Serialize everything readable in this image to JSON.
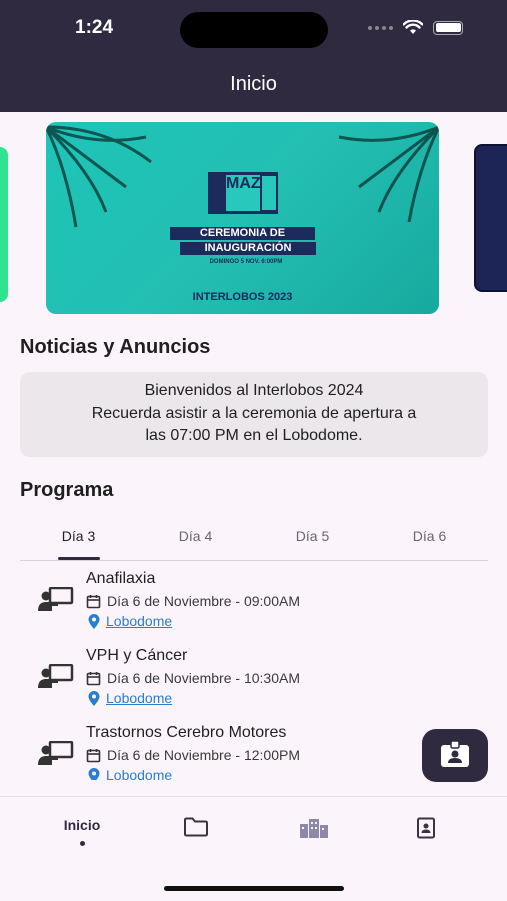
{
  "status_bar": {
    "time": "1:24"
  },
  "header": {
    "title": "Inicio"
  },
  "banner": {
    "logo_text": "MAZA",
    "line1": "CEREMONIA DE",
    "line2": "INAUGURACIÓN",
    "date": "DOMINGO 5 NOV. 6:00PM",
    "brand": "INTERLOBOS 2023"
  },
  "news": {
    "title": "Noticias y Anuncios",
    "lines": [
      "Bienvenidos al Interlobos 2024",
      "Recuerda asistir a la ceremonia de apertura a",
      "las 07:00 PM en el Lobodome."
    ]
  },
  "program": {
    "title": "Programa",
    "tabs": [
      "Día 3",
      "Día 4",
      "Día 5",
      "Día 6"
    ],
    "items": [
      {
        "title": "Anafilaxia",
        "date": "Día 6 de Noviembre - 09:00AM",
        "location": "Lobodome"
      },
      {
        "title": "VPH y Cáncer",
        "date": "Día 6 de Noviembre - 10:30AM",
        "location": "Lobodome"
      },
      {
        "title": "Trastornos Cerebro Motores",
        "date": "Día 6 de Noviembre - 12:00PM",
        "location": "Lobodome"
      }
    ]
  },
  "bottom_nav": {
    "home_label": "Inicio",
    "icons": [
      "folder-icon",
      "buildings-icon",
      "badge-icon"
    ]
  },
  "colors": {
    "header_bg": "#2f2a3f",
    "accent": "#2f2a3f",
    "link": "#2a7ecf",
    "banner_teal": "#1fc4b8"
  }
}
